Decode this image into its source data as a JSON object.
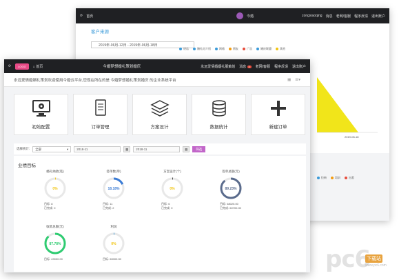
{
  "back": {
    "nav": {
      "home": "首页",
      "mid": "今婚",
      "user": "zongxiaoqing",
      "msg": "消息",
      "store": "老网/客服",
      "feedback": "程序反馈",
      "logout": "退出账户"
    },
    "section_title": "客户来源",
    "date_range": "2019年-06月-12日 - 2019年-06月-18日",
    "legend": [
      {
        "name": "进店",
        "color": "#3a9ad9"
      },
      {
        "name": "婚礼纪介绍",
        "color": "#3a9ad9"
      },
      {
        "name": "网络",
        "color": "#3a9ad9"
      },
      {
        "name": "朋友",
        "color": "#f39c12"
      },
      {
        "name": "广告",
        "color": "#e74c3c"
      },
      {
        "name": "婚庆联盟",
        "color": "#3a9ad9"
      },
      {
        "name": "其他",
        "color": "#f1c40f"
      }
    ],
    "x_tick": "2019-06-18",
    "legend2": [
      {
        "name": "拉新",
        "color": "#3a9ad9"
      },
      {
        "name": "培训",
        "color": "#f39c12"
      },
      {
        "name": "出差",
        "color": "#e74c3c"
      }
    ]
  },
  "front": {
    "nav": {
      "logo": "LOGO",
      "home": "首页",
      "center": "今婚梦想婚礼策划婚庆",
      "company": "永远爱情婚姻礼服策划",
      "msg": "消息",
      "badge": "3",
      "store": "老网/客服",
      "feedback": "程序反馈",
      "logout": "退出账户"
    },
    "welcome": "永远爱情婚姻礼策划欢迎使用今婚云平台,您现在所在的是 今婚梦想婚礼策划婚庆 的企业系统平台",
    "tiles": [
      {
        "name": "initial-setup",
        "label": "初始配置",
        "icon": "monitor-gear-icon"
      },
      {
        "name": "order-manage",
        "label": "订单管理",
        "icon": "document-list-icon"
      },
      {
        "name": "plan-design",
        "label": "方案设计",
        "icon": "layers-icon"
      },
      {
        "name": "data-stats",
        "label": "数据统计",
        "icon": "database-icon"
      },
      {
        "name": "new-order",
        "label": "新建订单",
        "icon": "plus-icon"
      }
    ],
    "filter": {
      "label": "选择统计:",
      "select": "全部",
      "date1": "2018-11",
      "date2": "2018-11",
      "button": "筛选"
    },
    "goals_title": "业绩目标",
    "gauges": [
      {
        "label": "婚礼纳款(笔)",
        "pct": "0%",
        "value": 0,
        "color": "#f1c40f",
        "target_label": "目标:",
        "target": "8",
        "done_label": "已完成:",
        "done": "0"
      },
      {
        "label": "签单数(单)",
        "pct": "18.18%",
        "value": 0.1818,
        "color": "#3a7bd5",
        "target_label": "目标:",
        "target": "11",
        "done_label": "已完成:",
        "done": "2"
      },
      {
        "label": "方案设计(个)",
        "pct": "0%",
        "value": 0,
        "color": "#333333",
        "target_label": "目标:",
        "target": "6",
        "done_label": "已完成:",
        "done": "0"
      },
      {
        "label": "签单总额(元)",
        "pct": "89.23%",
        "value": 0.8923,
        "color": "#5a6b8c",
        "target_label": "目标:",
        "target": "68025.00",
        "done_label": "已完成:",
        "done": "60700.00"
      },
      {
        "label": "收款总额(元)",
        "pct": "87.78%",
        "value": 0.8778,
        "color": "#2ecc71",
        "target_label": "目标:",
        "target": "49000.00",
        "done_label": "",
        "done": ""
      },
      {
        "label": "利润",
        "pct": "0%",
        "value": 0,
        "color": "#3a9ad9",
        "target_label": "目标:",
        "target": "60000.00",
        "done_label": "",
        "done": ""
      }
    ]
  },
  "watermark": {
    "main": "pc6",
    "tag": "下载站",
    "url": "www.pc6.com"
  }
}
